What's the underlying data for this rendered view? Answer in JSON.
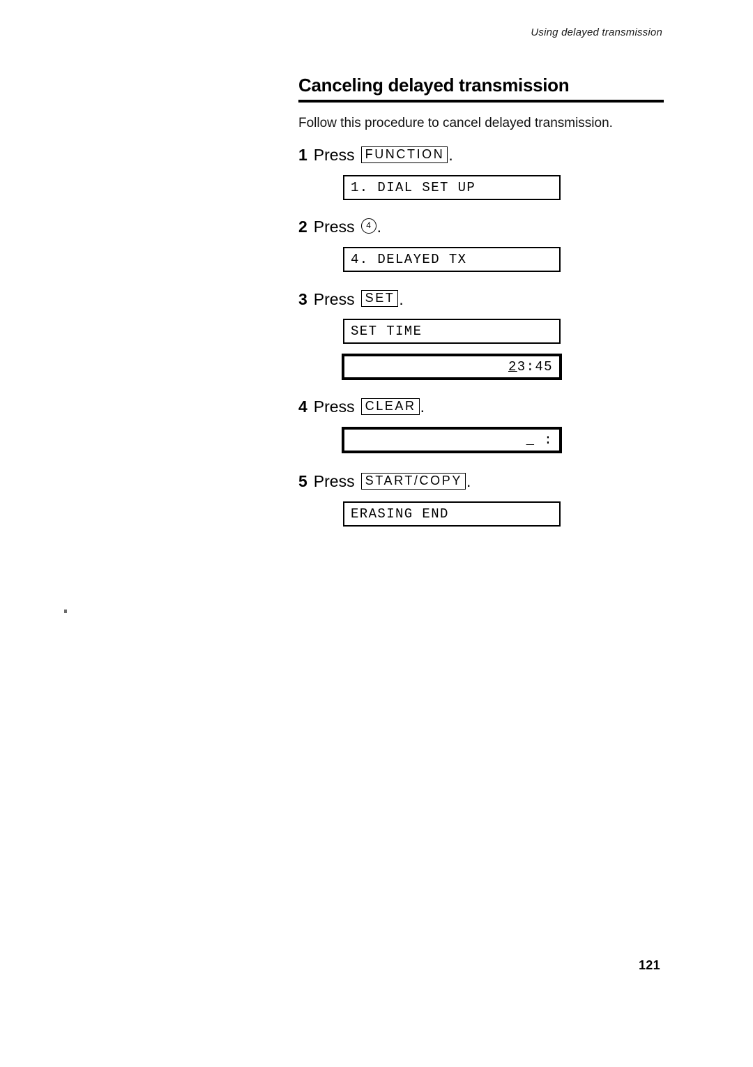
{
  "page": {
    "running_head": "Using delayed transmission",
    "page_number": "121"
  },
  "section": {
    "title": "Canceling delayed transmission",
    "intro": "Follow this procedure to cancel delayed transmission."
  },
  "steps": [
    {
      "number": "1",
      "verb": "Press",
      "key_label": "FUNCTION",
      "key_type": "keycap",
      "period": ".",
      "displays": [
        {
          "text": "1. DIAL SET UP",
          "align": "left",
          "style": "normal"
        }
      ]
    },
    {
      "number": "2",
      "verb": "Press",
      "key_label": "4",
      "key_type": "circle",
      "period": ".",
      "displays": [
        {
          "text": "4. DELAYED TX",
          "align": "left",
          "style": "normal"
        }
      ]
    },
    {
      "number": "3",
      "verb": "Press",
      "key_label": "SET",
      "key_type": "keycap",
      "period": ".",
      "displays": [
        {
          "text": "SET TIME",
          "align": "left",
          "style": "normal"
        },
        {
          "text": "23:45",
          "cursor_char": "2",
          "rest": "3:45",
          "align": "right",
          "style": "thick"
        }
      ]
    },
    {
      "number": "4",
      "verb": "Press",
      "key_label": "CLEAR",
      "key_type": "keycap",
      "period": ".",
      "displays": [
        {
          "text": "_ :",
          "align": "right",
          "style": "thick"
        }
      ]
    },
    {
      "number": "5",
      "verb": "Press",
      "key_label": "START/COPY",
      "key_type": "keycap",
      "period": ".",
      "displays": [
        {
          "text": "ERASING END",
          "align": "left",
          "style": "normal"
        }
      ]
    }
  ]
}
